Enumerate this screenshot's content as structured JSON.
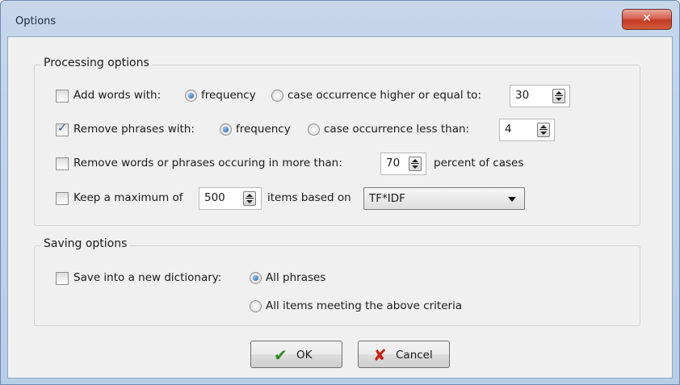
{
  "window": {
    "title": "Options",
    "close_glyph": "✕"
  },
  "processing": {
    "legend": "Processing options",
    "add_words": {
      "label": "Add words with:",
      "checked": false,
      "radio_frequency": "frequency",
      "radio_case": "case occurrence higher or equal to:",
      "selected": "frequency",
      "value": "30"
    },
    "remove_phrases": {
      "label": "Remove phrases with:",
      "checked": true,
      "radio_frequency": "frequency",
      "radio_case": "case occurrence less than:",
      "selected": "frequency",
      "value": "4"
    },
    "remove_words": {
      "label": "Remove words or phrases occuring in more than:",
      "checked": false,
      "value": "70",
      "suffix": "percent of cases"
    },
    "keep_max": {
      "label": "Keep a maximum of",
      "checked": false,
      "value": "500",
      "middle": "items based on",
      "combo_value": "TF*IDF"
    }
  },
  "saving": {
    "legend": "Saving options",
    "save_dictionary": {
      "label": "Save into a new dictionary:",
      "checked": false,
      "radio_all_phrases": "All phrases",
      "radio_all_items": "All items meeting the above criteria",
      "selected": "All phrases"
    }
  },
  "buttons": {
    "ok": "OK",
    "cancel": "Cancel"
  },
  "icons": {
    "ok": "check-icon",
    "cancel": "x-icon",
    "ok_color": "#2f8a1f",
    "cancel_color": "#c0211a"
  }
}
